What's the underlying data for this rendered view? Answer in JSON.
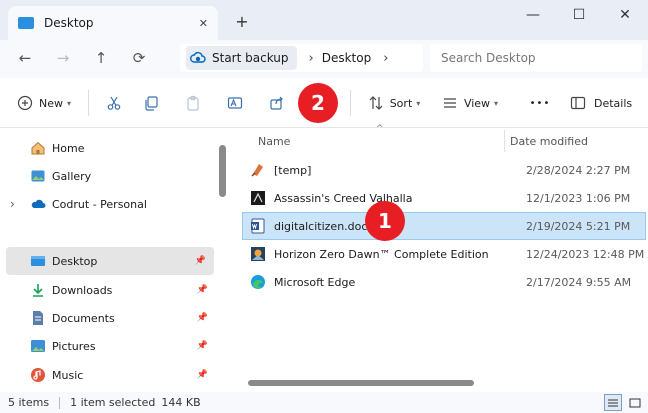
{
  "window": {
    "tab_title": "Desktop",
    "new_tab": "+",
    "minimize": "—",
    "maximize": "☐",
    "close": "✕"
  },
  "nav": {
    "back": "←",
    "forward": "→",
    "up": "↑",
    "refresh": "⟳",
    "breadcrumb": [
      "Start backup",
      "Desktop"
    ],
    "separator": "›",
    "search_placeholder": "Search Desktop"
  },
  "toolbar": {
    "new_label": "New",
    "sort_label": "Sort",
    "view_label": "View",
    "more": "•••",
    "details_label": "Details"
  },
  "callouts": {
    "first": "1",
    "second": "2"
  },
  "sidebar": {
    "items": [
      {
        "label": "Home",
        "icon": "home-icon"
      },
      {
        "label": "Gallery",
        "icon": "gallery-icon"
      },
      {
        "label": "Codrut - Personal",
        "icon": "onedrive-icon"
      },
      {
        "label": "Desktop",
        "icon": "desktop-icon"
      },
      {
        "label": "Downloads",
        "icon": "downloads-icon"
      },
      {
        "label": "Documents",
        "icon": "documents-icon"
      },
      {
        "label": "Pictures",
        "icon": "pictures-icon"
      },
      {
        "label": "Music",
        "icon": "music-icon"
      }
    ],
    "pin": "📌",
    "expand": "›"
  },
  "files": {
    "columns": {
      "name": "Name",
      "date": "Date modified"
    },
    "sort_arrow": "^",
    "rows": [
      {
        "name": "[temp]",
        "date": "2/28/2024 2:27 PM"
      },
      {
        "name": "Assassin's Creed Valhalla",
        "date": "12/1/2023 1:06 PM"
      },
      {
        "name": "digitalcitizen.docx",
        "date": "2/19/2024 5:21 PM"
      },
      {
        "name": "Horizon Zero Dawn™ Complete Edition",
        "date": "12/24/2023 12:48 PM"
      },
      {
        "name": "Microsoft Edge",
        "date": "2/17/2024 9:55 AM"
      }
    ]
  },
  "status": {
    "item_count": "5 items",
    "selection": "1 item selected",
    "size": "144 KB"
  },
  "colors": {
    "accent": "#0067c0",
    "selected_bg": "#cce4f7",
    "callout": "#e81e25"
  }
}
